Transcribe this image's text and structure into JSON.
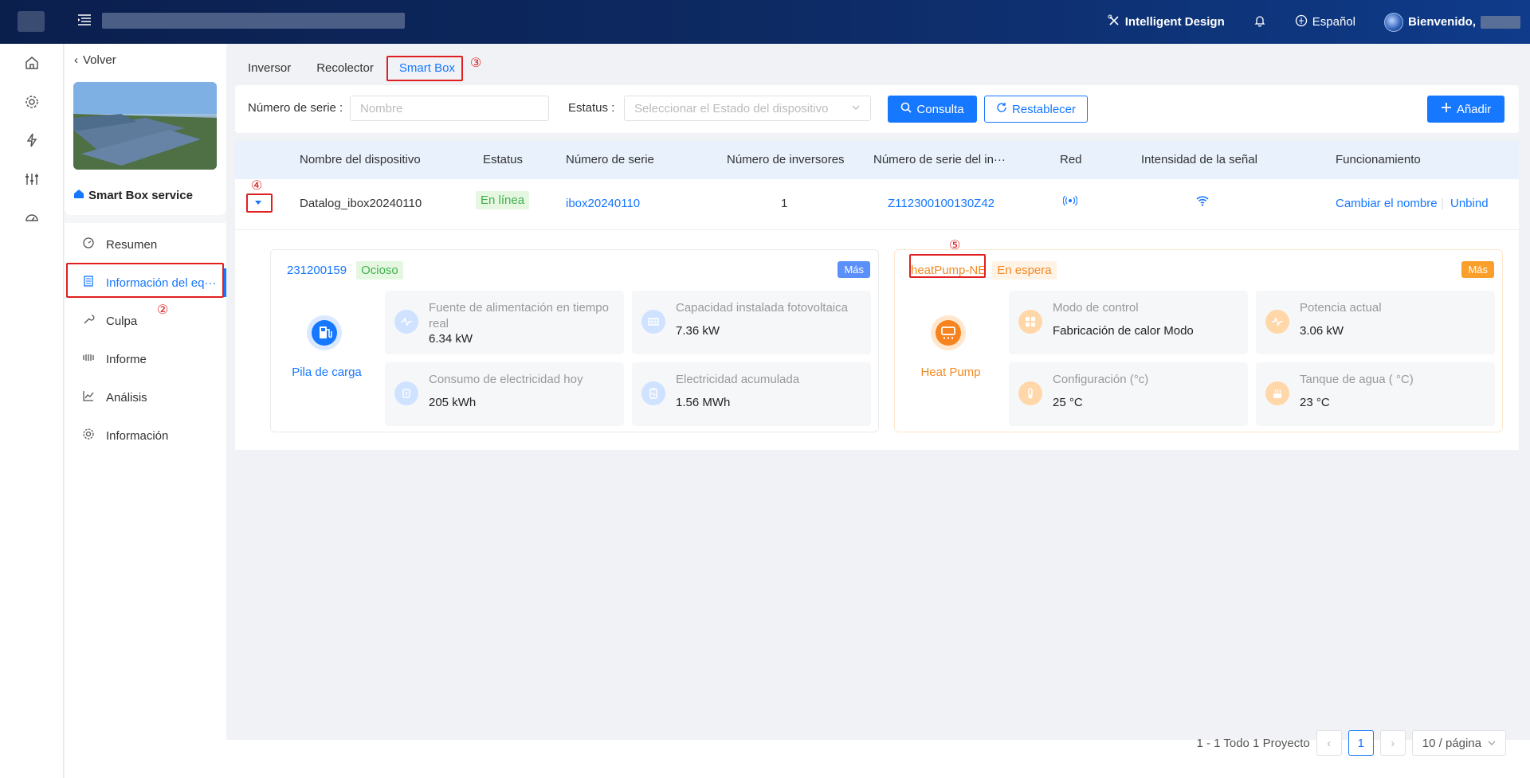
{
  "header": {
    "intelligent_design": "Intelligent Design",
    "language": "Español",
    "welcome": "Bienvenido,"
  },
  "sidebar_rail": {
    "icons": [
      "home-icon",
      "gear-icon",
      "lightning-icon",
      "sliders-icon",
      "gauge-icon"
    ]
  },
  "left_panel": {
    "back": "Volver",
    "station_name": "Smart Box service",
    "menu": [
      {
        "label": "Resumen",
        "icon": "dashboard-icon"
      },
      {
        "label": "Información del eq···",
        "icon": "document-icon"
      },
      {
        "label": "Culpa",
        "icon": "wrench-icon"
      },
      {
        "label": "Informe",
        "icon": "report-icon"
      },
      {
        "label": "Análisis",
        "icon": "chart-icon"
      },
      {
        "label": "Información",
        "icon": "settings-icon"
      }
    ]
  },
  "tabs": [
    "Inversor",
    "Recolector",
    "Smart Box"
  ],
  "filters": {
    "serial_label": "Número de serie",
    "serial_placeholder": "Nombre",
    "status_label": "Estatus",
    "status_placeholder": "Seleccionar el Estado del dispositivo",
    "query": "Consulta",
    "reset": "Restablecer",
    "add": "Añadir"
  },
  "table": {
    "headers": [
      "Nombre del dispositivo",
      "Estatus",
      "Número de serie",
      "Número de inversores",
      "Número de serie del in···",
      "Red",
      "Intensidad de la señal",
      "Funcionamiento"
    ],
    "row": {
      "name": "Datalog_ibox20240110",
      "status": "En línea",
      "serial": "ibox20240110",
      "inverters": "1",
      "inverter_serial": "Z112300100130Z42",
      "rename": "Cambiar el nombre",
      "unbind": "Unbind"
    }
  },
  "cards": [
    {
      "id": "231200159",
      "status": "Ocioso",
      "more": "Más",
      "device_label": "Pila de carga",
      "metrics": [
        {
          "label": "Fuente de alimentación en tiempo real",
          "value": "6.34 kW"
        },
        {
          "label": "Capacidad instalada fotovoltaica",
          "value": "7.36 kW"
        },
        {
          "label": "Consumo de electricidad hoy",
          "value": "205 kWh"
        },
        {
          "label": "Electricidad acumulada",
          "value": "1.56 MWh"
        }
      ]
    },
    {
      "id": "heatPump-NE",
      "status": "En espera",
      "more": "Más",
      "device_label": "Heat Pump",
      "metrics": [
        {
          "label": "Modo de control",
          "value": "Fabricación de calor Modo"
        },
        {
          "label": "Potencia actual",
          "value": "3.06 kW"
        },
        {
          "label": "Configuración (°c)",
          "value": "25 °C"
        },
        {
          "label": "Tanque de agua ( °C)",
          "value": "23 °C"
        }
      ]
    }
  ],
  "annotations": [
    "②",
    "③",
    "④",
    "⑤"
  ],
  "pagination": {
    "summary": "1 - 1 Todo 1 Proyecto",
    "page": "1",
    "page_size": "10 / página"
  }
}
